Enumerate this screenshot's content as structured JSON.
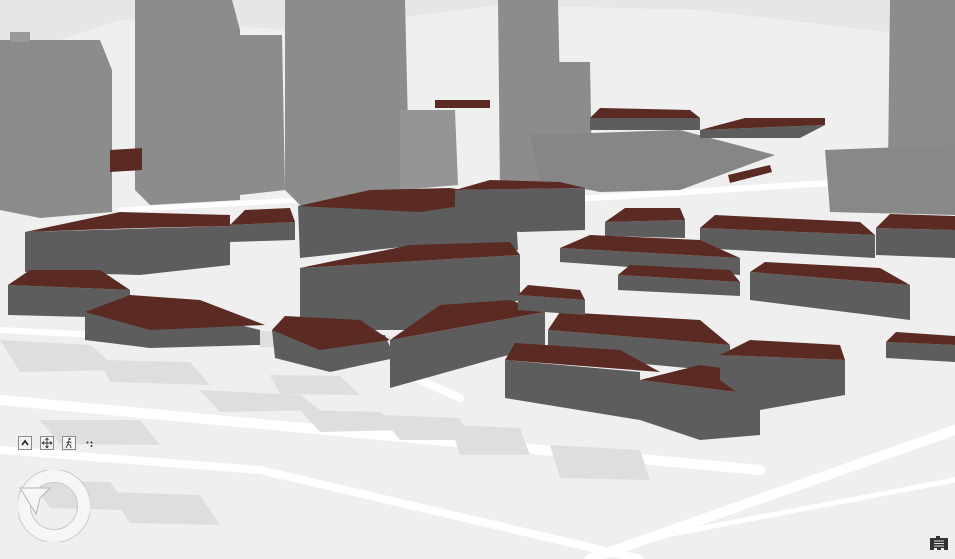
{
  "map": {
    "view": "3D scene",
    "colors": {
      "ground": "#efefef",
      "road": "#ffffff",
      "ground_footprint": "#dedede",
      "tower": "#8c8c8c",
      "building_wall": "#5d5d5d",
      "building_roof": "#5b2a22"
    }
  },
  "controls": {
    "zoom_up_icon": "chevron-up-icon",
    "pan_icon": "pan-arrows-icon",
    "walk_icon": "walk-person-icon",
    "more_icon": "dots-icon",
    "compass_icon": "compass-icon",
    "legend_icon": "layer-list-icon"
  }
}
